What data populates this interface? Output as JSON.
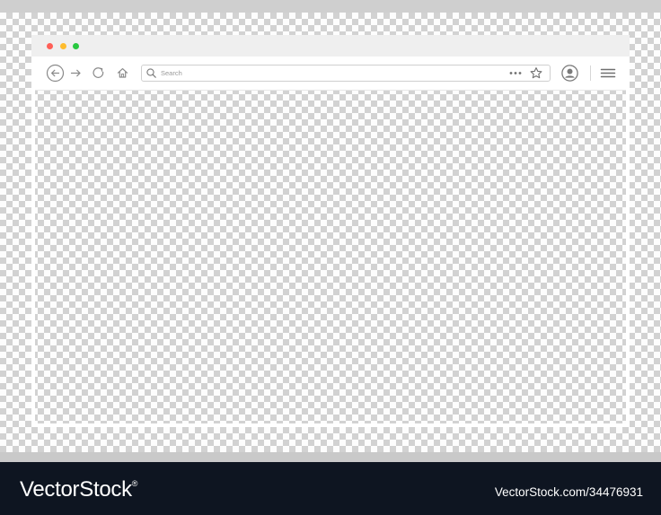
{
  "window": {
    "controls": {
      "close_color": "#ff5f57",
      "minimize_color": "#febc2e",
      "maximize_color": "#28c840"
    }
  },
  "toolbar": {
    "icons": [
      "back-arrow-icon",
      "forward-arrow-icon",
      "reload-icon",
      "home-icon",
      "search-icon",
      "more-dots-icon",
      "star-icon",
      "account-icon",
      "hamburger-menu-icon"
    ],
    "search_placeholder": "Search"
  },
  "footer": {
    "brand": "VectorStock",
    "brand_mark": "®",
    "image_id": "VectorStock.com/34476931",
    "background": "#0e1521"
  }
}
